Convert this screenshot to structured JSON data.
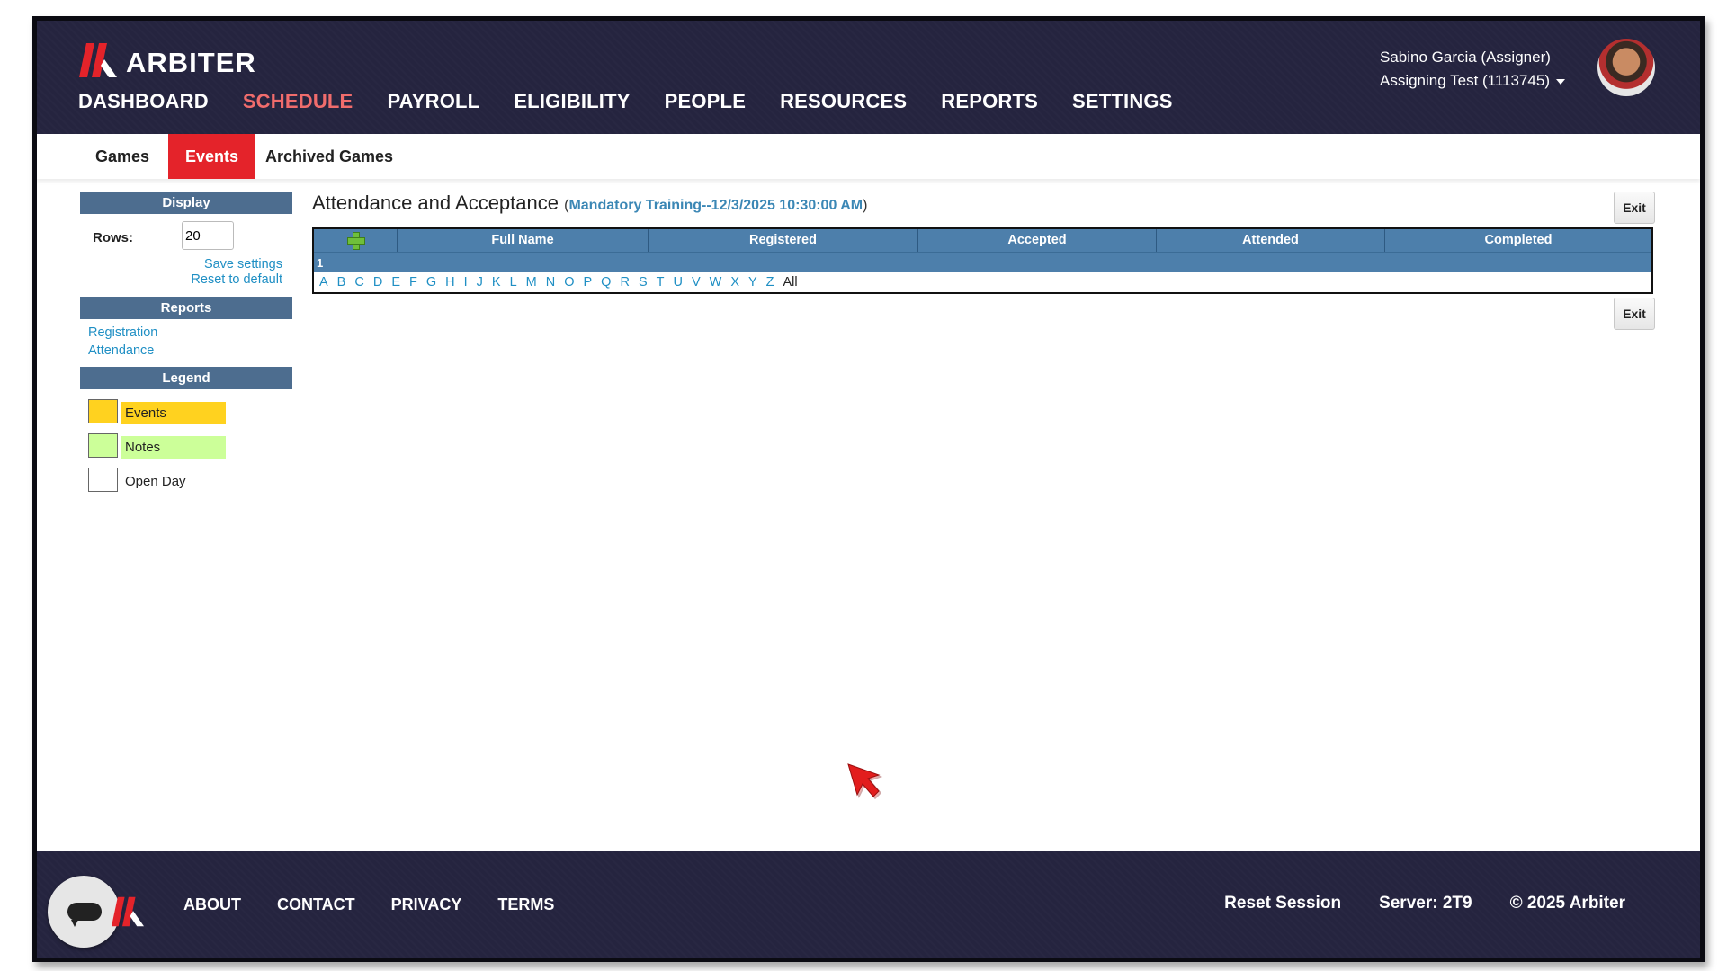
{
  "header": {
    "brand": "ARBITER",
    "nav": [
      {
        "label": "DASHBOARD",
        "active": false
      },
      {
        "label": "SCHEDULE",
        "active": true
      },
      {
        "label": "PAYROLL",
        "active": false
      },
      {
        "label": "ELIGIBILITY",
        "active": false
      },
      {
        "label": "PEOPLE",
        "active": false
      },
      {
        "label": "RESOURCES",
        "active": false
      },
      {
        "label": "REPORTS",
        "active": false
      },
      {
        "label": "SETTINGS",
        "active": false
      }
    ],
    "user_name": "Sabino Garcia (Assigner)",
    "account": "Assigning Test (1113745)"
  },
  "subtabs": [
    {
      "label": "Games",
      "active": false
    },
    {
      "label": "Events",
      "active": true
    },
    {
      "label": "Archived Games",
      "active": false
    }
  ],
  "sidebar": {
    "display_heading": "Display",
    "rows_label": "Rows:",
    "rows_value": "20",
    "save_settings": "Save settings",
    "reset_default": "Reset to default",
    "reports_heading": "Reports",
    "reports": [
      "Registration",
      "Attendance"
    ],
    "legend_heading": "Legend",
    "legend": [
      {
        "label": "Events",
        "color": "#ffd21f"
      },
      {
        "label": "Notes",
        "color": "#ccff99"
      },
      {
        "label": "Open Day",
        "color": "#ffffff"
      }
    ]
  },
  "main": {
    "title": "Attendance and Acceptance",
    "open_paren": "(",
    "subtitle": "Mandatory Training--12/3/2025 10:30:00 AM",
    "close_paren": ")",
    "exit_label": "Exit",
    "columns": [
      "Full Name",
      "Registered",
      "Accepted",
      "Attended",
      "Completed"
    ],
    "page_number": "1",
    "letters": [
      "A",
      "B",
      "C",
      "D",
      "E",
      "F",
      "G",
      "H",
      "I",
      "J",
      "K",
      "L",
      "M",
      "N",
      "O",
      "P",
      "Q",
      "R",
      "S",
      "T",
      "U",
      "V",
      "W",
      "X",
      "Y",
      "Z"
    ],
    "all_label": "All"
  },
  "footer": {
    "links": [
      "ABOUT",
      "CONTACT",
      "PRIVACY",
      "TERMS"
    ],
    "reset_session": "Reset Session",
    "server": "Server: 2T9",
    "copyright": "© 2025 Arbiter"
  },
  "colors": {
    "brand_red": "#e4232a",
    "header_bg": "#25243f",
    "table_header": "#4d7fab",
    "link": "#1f8fc4"
  }
}
